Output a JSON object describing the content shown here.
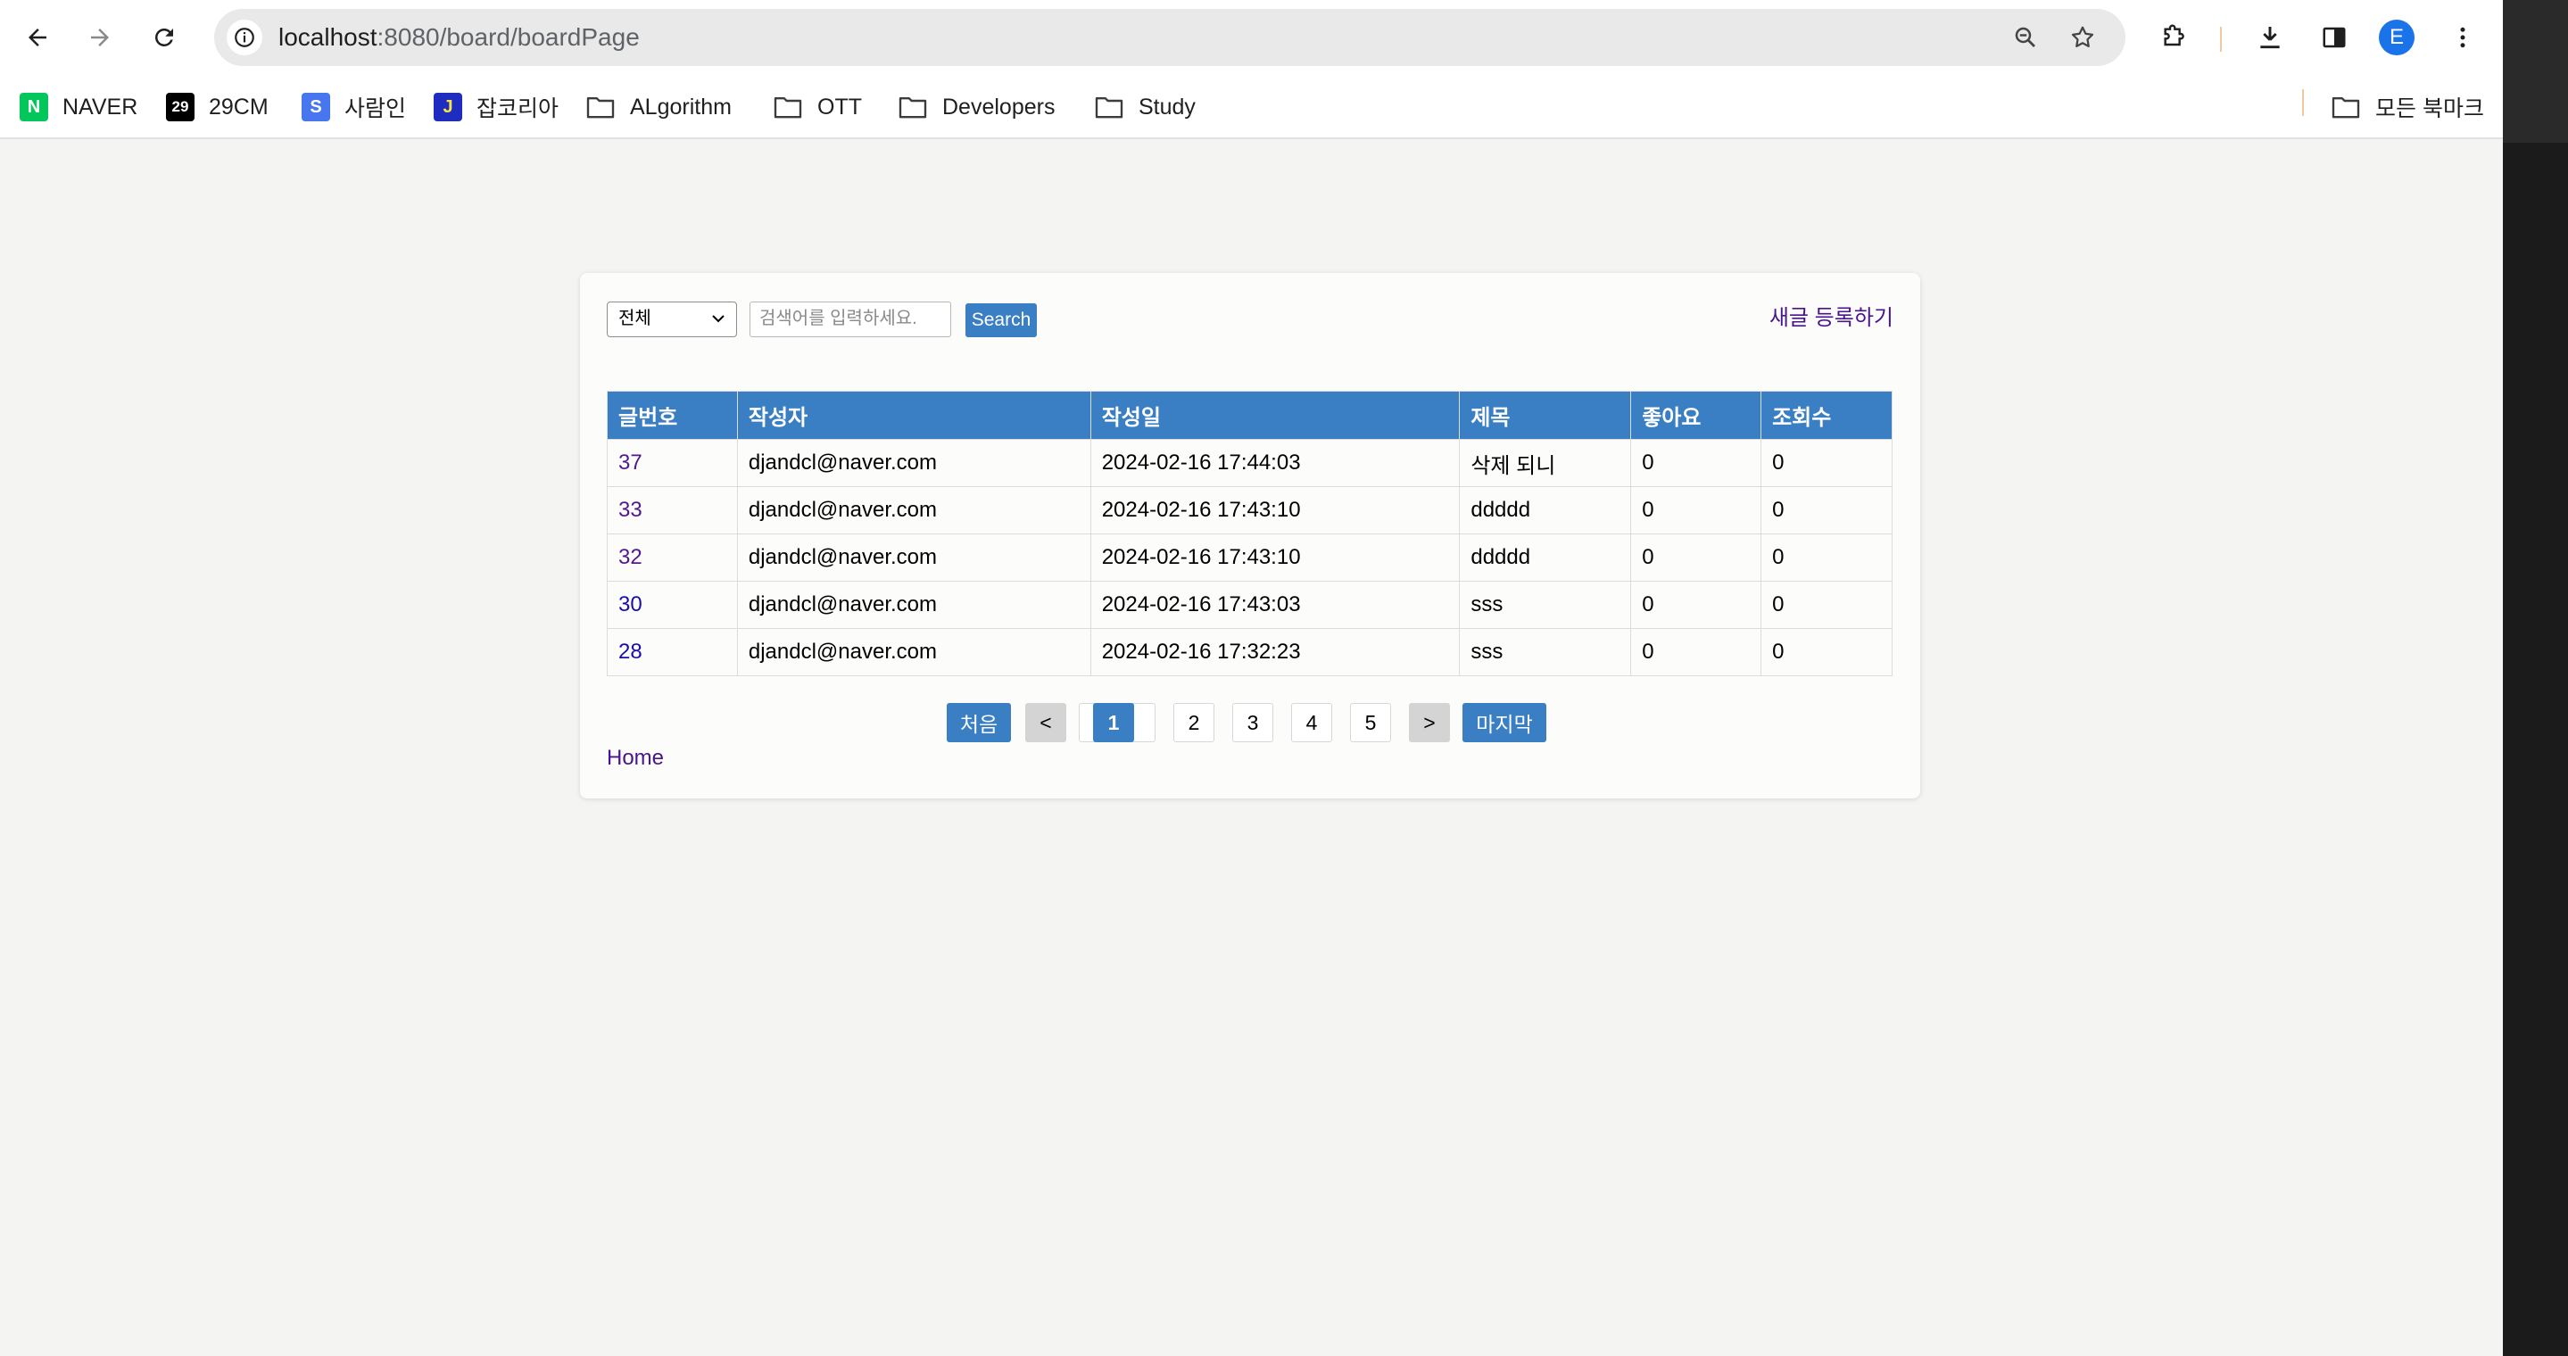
{
  "browser": {
    "url_host": "localhost",
    "url_path": ":8080/board/boardPage",
    "avatar_letter": "E"
  },
  "bookmarks": [
    {
      "label": "NAVER",
      "icon": "naver-icon",
      "fav": "N",
      "color": "#03c75a"
    },
    {
      "label": "29CM",
      "icon": "29cm-icon",
      "fav": "29",
      "color": "#000000"
    },
    {
      "label": "사람인",
      "icon": "saramin-icon",
      "fav": "S",
      "color": "#4876ef"
    },
    {
      "label": "잡코리아",
      "icon": "jobkorea-icon",
      "fav": "J",
      "color": "#1e2dbf"
    },
    {
      "label": "ALgorithm",
      "icon": "folder-icon"
    },
    {
      "label": "OTT",
      "icon": "folder-icon"
    },
    {
      "label": "Developers",
      "icon": "folder-icon"
    },
    {
      "label": "Study",
      "icon": "folder-icon"
    }
  ],
  "all_bookmarks_label": "모든 북마크",
  "search": {
    "type_selected": "전체",
    "placeholder": "검색어를 입력하세요.",
    "button": "Search"
  },
  "write_link": "새글 등록하기",
  "table": {
    "headers": [
      "글번호",
      "작성자",
      "작성일",
      "제목",
      "좋아요",
      "조회수"
    ],
    "rows": [
      [
        "37",
        "djandcl@naver.com",
        "2024-02-16 17:44:03",
        "삭제 되니",
        "0",
        "0"
      ],
      [
        "33",
        "djandcl@naver.com",
        "2024-02-16 17:43:10",
        "ddddd",
        "0",
        "0"
      ],
      [
        "32",
        "djandcl@naver.com",
        "2024-02-16 17:43:10",
        "ddddd",
        "0",
        "0"
      ],
      [
        "30",
        "djandcl@naver.com",
        "2024-02-16 17:43:03",
        "sss",
        "0",
        "0"
      ],
      [
        "28",
        "djandcl@naver.com",
        "2024-02-16 17:32:23",
        "sss",
        "0",
        "0"
      ]
    ]
  },
  "pagination": {
    "first": "처음",
    "prev": "<",
    "pages": [
      "1",
      "2",
      "3",
      "4",
      "5"
    ],
    "current": "1",
    "next": ">",
    "last": "마지막"
  },
  "home_link": "Home",
  "colors": {
    "accent": "#3a7ec4",
    "link_visited": "#4a148c",
    "link": "#1a0dab"
  }
}
